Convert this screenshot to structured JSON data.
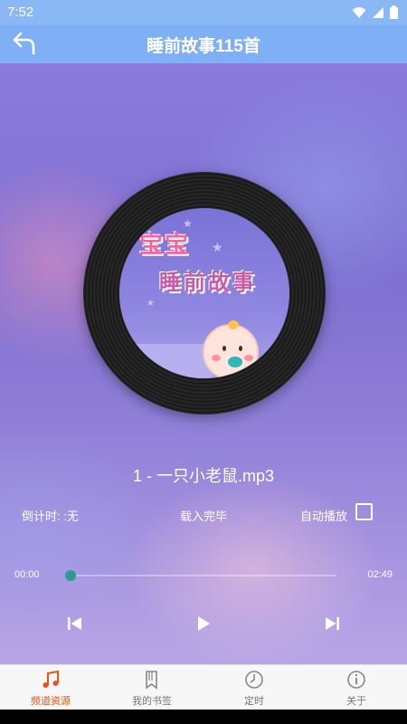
{
  "status_bar": {
    "time": "7:52"
  },
  "header": {
    "title": "睡前故事115首"
  },
  "cover": {
    "line1": "宝宝",
    "line2": "睡前故事"
  },
  "player": {
    "track_name": "1 - 一只小老鼠.mp3",
    "countdown": "倒计时: :无",
    "load_status": "载入完毕",
    "autoplay_label": "自动播放",
    "autoplay_checked": false,
    "current_time": "00:00",
    "total_time": "02:49",
    "progress_fraction": 0.0
  },
  "bottom_nav": {
    "items": [
      {
        "label": "频道资源",
        "icon": "music-note-icon",
        "active": true
      },
      {
        "label": "我的书签",
        "icon": "bookmark-icon",
        "active": false
      },
      {
        "label": "定时",
        "icon": "timer-icon",
        "active": false
      },
      {
        "label": "关于",
        "icon": "info-icon",
        "active": false
      }
    ]
  },
  "colors": {
    "app_bar": "#7fb0f6",
    "accent_active": "#e8541c",
    "seek": "#2a9d8f"
  }
}
